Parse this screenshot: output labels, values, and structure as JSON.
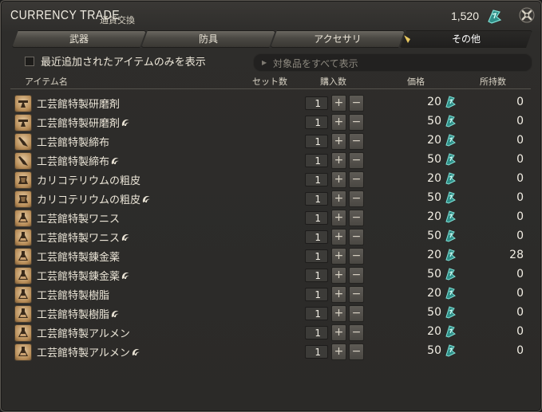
{
  "window": {
    "title": "CURRENCY TRADE",
    "subtitle": "通貨交換",
    "balance": "1,520"
  },
  "tabs": [
    {
      "label": "武器",
      "active": false
    },
    {
      "label": "防具",
      "active": false
    },
    {
      "label": "アクセサリ",
      "active": false
    },
    {
      "label": "その他",
      "active": true
    }
  ],
  "filter": {
    "checkbox_label": "最近追加されたアイテムのみを表示",
    "show_all_label": "対象品をすべて表示"
  },
  "columns": {
    "item": "アイテム名",
    "set_count": "セット数",
    "purchase_qty": "購入数",
    "price": "価格",
    "owned": "所持数"
  },
  "colors": {
    "accent_teal": "#3fb8b0",
    "item_icon": "#c9a06a",
    "text": "#ece6d8"
  },
  "items": [
    {
      "name": "工芸館特製研磨剤",
      "hq": false,
      "qty": "1",
      "price": "20",
      "owned": "0",
      "icon": "hammer-icon"
    },
    {
      "name": "工芸館特製研磨剤",
      "hq": true,
      "qty": "1",
      "price": "50",
      "owned": "0",
      "icon": "hammer-icon"
    },
    {
      "name": "工芸館特製締布",
      "hq": false,
      "qty": "1",
      "price": "20",
      "owned": "0",
      "icon": "cloth-icon"
    },
    {
      "name": "工芸館特製締布",
      "hq": true,
      "qty": "1",
      "price": "50",
      "owned": "0",
      "icon": "cloth-icon"
    },
    {
      "name": "カリコテリウムの粗皮",
      "hq": false,
      "qty": "1",
      "price": "20",
      "owned": "0",
      "icon": "hide-icon"
    },
    {
      "name": "カリコテリウムの粗皮",
      "hq": true,
      "qty": "1",
      "price": "50",
      "owned": "0",
      "icon": "hide-icon"
    },
    {
      "name": "工芸館特製ワニス",
      "hq": false,
      "qty": "1",
      "price": "20",
      "owned": "0",
      "icon": "flask-icon"
    },
    {
      "name": "工芸館特製ワニス",
      "hq": true,
      "qty": "1",
      "price": "50",
      "owned": "0",
      "icon": "flask-icon"
    },
    {
      "name": "工芸館特製錬金薬",
      "hq": false,
      "qty": "1",
      "price": "20",
      "owned": "28",
      "icon": "flask-icon"
    },
    {
      "name": "工芸館特製錬金薬",
      "hq": true,
      "qty": "1",
      "price": "50",
      "owned": "0",
      "icon": "flask-icon"
    },
    {
      "name": "工芸館特製樹脂",
      "hq": false,
      "qty": "1",
      "price": "20",
      "owned": "0",
      "icon": "flask-icon"
    },
    {
      "name": "工芸館特製樹脂",
      "hq": true,
      "qty": "1",
      "price": "50",
      "owned": "0",
      "icon": "flask-icon"
    },
    {
      "name": "工芸館特製アルメン",
      "hq": false,
      "qty": "1",
      "price": "20",
      "owned": "0",
      "icon": "flask-icon"
    },
    {
      "name": "工芸館特製アルメン",
      "hq": true,
      "qty": "1",
      "price": "50",
      "owned": "0",
      "icon": "flask-icon"
    }
  ]
}
